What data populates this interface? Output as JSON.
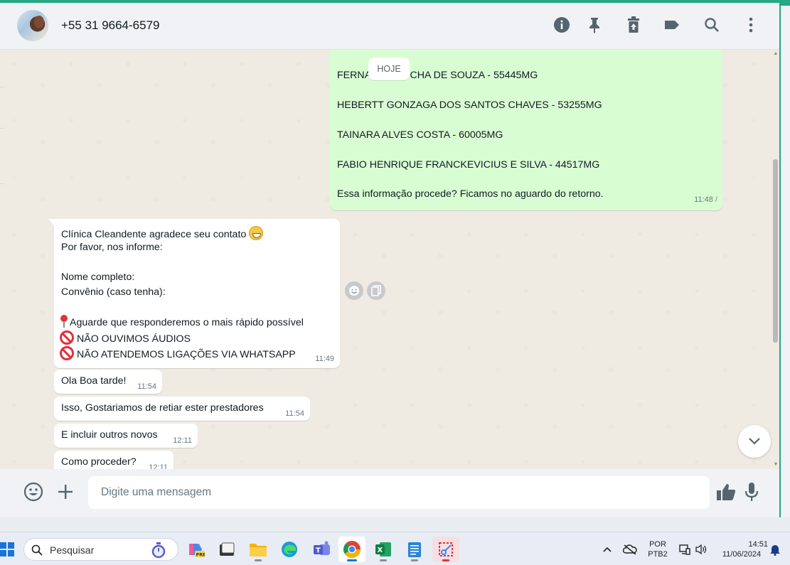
{
  "header": {
    "contact_name": "+55 31 9664-6579",
    "icons": [
      "info-icon",
      "pin-icon",
      "delete-icon",
      "label-icon",
      "search-icon",
      "menu-icon"
    ]
  },
  "chat": {
    "date_divider": "HOJE",
    "outgoing": {
      "lines": [
        "FERNANDA ROCHA DE SOUZA - 55445MG",
        "HEBERTT GONZAGA DOS SANTOS CHAVES - 53255MG",
        "TAINARA ALVES COSTA - 60005MG",
        "FABIO HENRIQUE FRANCKEVICIUS E SILVA - 44517MG",
        "Essa informação procede? Ficamos no aguardo do retorno."
      ],
      "time": "11:48"
    },
    "incoming": [
      {
        "lines": [
          "Clínica Cleandente agradece seu contato",
          "Por favor, nos informe:",
          "Nome completo:",
          "Convênio (caso tenha):",
          "Aguarde que responderemos o mais rápido possível",
          "NÃO OUVIMOS ÁUDIOS",
          "NÃO ATENDEMOS LIGAÇÕES VIA WHATSAPP"
        ],
        "time": "11:49"
      },
      {
        "text": "Ola Boa tarde!",
        "time": "11:54"
      },
      {
        "text": "Isso, Gostariamos de retiar ester prestadores",
        "time": "11:54"
      },
      {
        "text": "E incluir outros novos",
        "time": "12:11"
      },
      {
        "text": "Como proceder?",
        "time": "12:11"
      }
    ]
  },
  "composer": {
    "placeholder": "Digite uma mensagem"
  },
  "taskbar": {
    "search_label": "Pesquisar",
    "language": "POR",
    "layout": "PTB2",
    "time": "14:51",
    "date": "11/06/2024"
  },
  "colors": {
    "accent": "#25a884",
    "outgoing_bubble": "#d9fdd3",
    "incoming_bubble": "#ffffff",
    "chat_bg": "#efeae2"
  }
}
